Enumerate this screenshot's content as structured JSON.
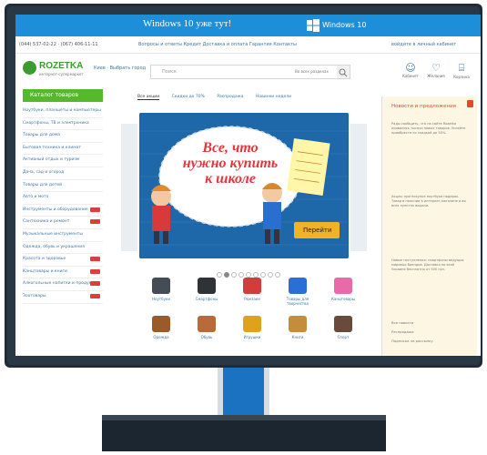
{
  "window": {
    "title": "Windows 10 уже тут!",
    "logo_label": "Windows 10"
  },
  "topnav": {
    "phone": "(044) 537-02-22 · (067) 406-11-11",
    "links": "Вопросы и ответы  Кредит  Доставка и оплата  Гарантия  Контакты",
    "login": "войдите в личный кабинет"
  },
  "header": {
    "logo": "ROZETKA",
    "logo_sub": "интернет-супермаркет",
    "city": "Киев · Выбрать город",
    "search_placeholder": "Поиск",
    "search_category": "Во всех разделах",
    "icons": [
      {
        "name": "user-icon",
        "glyph": "☺",
        "label": "Кабинет"
      },
      {
        "name": "heart-icon",
        "glyph": "♡",
        "label": "Желания"
      },
      {
        "name": "cart-icon",
        "glyph": "⌸",
        "label": "Корзина"
      }
    ]
  },
  "sidebar": {
    "button": "Каталог товаров",
    "categories": [
      {
        "label": "Ноутбуки, планшеты и компьютеры",
        "tag": false
      },
      {
        "label": "Смартфоны, ТВ и электроника",
        "tag": false
      },
      {
        "label": "Товары для дома",
        "tag": false
      },
      {
        "label": "Бытовая техника и климат",
        "tag": false
      },
      {
        "label": "Активный отдых и туризм",
        "tag": false
      },
      {
        "label": "Дача, сад и огород",
        "tag": false
      },
      {
        "label": "Товары для детей",
        "tag": false
      },
      {
        "label": "Авто и мото",
        "tag": false
      },
      {
        "label": "Инструменты и оборудование",
        "tag": true
      },
      {
        "label": "Сантехника и ремонт",
        "tag": true
      },
      {
        "label": "Музыкальные инструменты",
        "tag": false
      },
      {
        "label": "Одежда, обувь и украшения",
        "tag": false
      },
      {
        "label": "Красота и здоровье",
        "tag": true
      },
      {
        "label": "Канцтовары и книги",
        "tag": true
      },
      {
        "label": "Алкогольные напитки и продукты",
        "tag": true
      },
      {
        "label": "Зоотовары",
        "tag": true
      }
    ]
  },
  "tabs": [
    "Все акции",
    "Скидки до 70%",
    "Распродажа",
    "Новинки недели"
  ],
  "banner": {
    "line1": "Все, что",
    "line2": "нужно купить",
    "line3": "к школе",
    "cta": "Перейти"
  },
  "products": [
    {
      "label": "Ноутбуки",
      "color": "#444c55"
    },
    {
      "label": "Смартфоны",
      "color": "#2e3338"
    },
    {
      "label": "Рюкзаки",
      "color": "#d03d3d"
    },
    {
      "label": "Товары для творчества",
      "color": "#2b6fd6"
    },
    {
      "label": "Канцтовары",
      "color": "#e86aa8"
    },
    {
      "label": "Одежда",
      "color": "#9b5a2a"
    },
    {
      "label": "Обувь",
      "color": "#b86a3a"
    },
    {
      "label": "Игрушки",
      "color": "#e0a21a"
    },
    {
      "label": "Книги",
      "color": "#c58c3b"
    },
    {
      "label": "Спорт",
      "color": "#6a4a3a"
    }
  ],
  "news": {
    "title": "Новости и предложения",
    "paragraphs": [
      "Рады сообщить, что на сайте Rozetka появились тысячи новых товаров. Успейте приобрести со скидкой до 50%.",
      "Акция: при покупке ноутбука подарок. Товар в наличии в интернет-магазине и во всех пунктах выдачи.",
      "Новые поступления: смартфоны ведущих мировых брендов. Доставка по всей Украине бесплатно от 500 грн."
    ],
    "footer": [
      "Все новости",
      "Распродажа",
      "Подписка на рассылку"
    ]
  },
  "colors": {
    "win_bar": "#1d8ed8",
    "accent_green": "#56b82b",
    "link_blue": "#3e77aa",
    "banner_cta": "#f0b323"
  }
}
